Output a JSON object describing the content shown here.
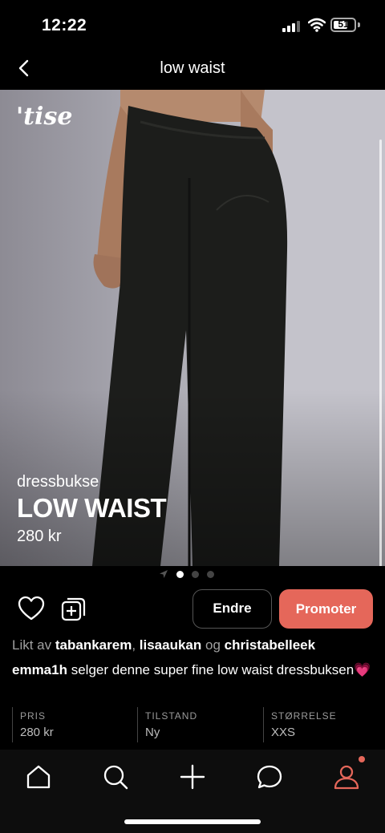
{
  "status_bar": {
    "time": "12:22",
    "battery": "51"
  },
  "header": {
    "title": "low waist"
  },
  "brand": {
    "logo": "'tise"
  },
  "product": {
    "category": "dressbukse",
    "title": "LOW WAIST",
    "price": "280 kr",
    "images": {
      "count": 3,
      "current": 1
    }
  },
  "actions": {
    "edit_label": "Endre",
    "promote_label": "Promoter"
  },
  "likes": {
    "prefix": "Likt av",
    "users": [
      "tabankarem",
      "lisaaukan",
      "christabelleek"
    ],
    "sep": ",",
    "and": "og"
  },
  "description": {
    "seller": "emma1h",
    "text": "selger denne super fine low waist dressbuksen💗"
  },
  "details": [
    {
      "label": "PRIS",
      "value": "280 kr"
    },
    {
      "label": "TILSTAND",
      "value": "Ny"
    },
    {
      "label": "STØRRELSE",
      "value": "XXS"
    }
  ],
  "tab_bar": {
    "items": [
      "home-icon",
      "search-icon",
      "add-icon",
      "chat-icon",
      "profile-icon"
    ],
    "active": "profile-icon",
    "accent": "#e5675a"
  }
}
